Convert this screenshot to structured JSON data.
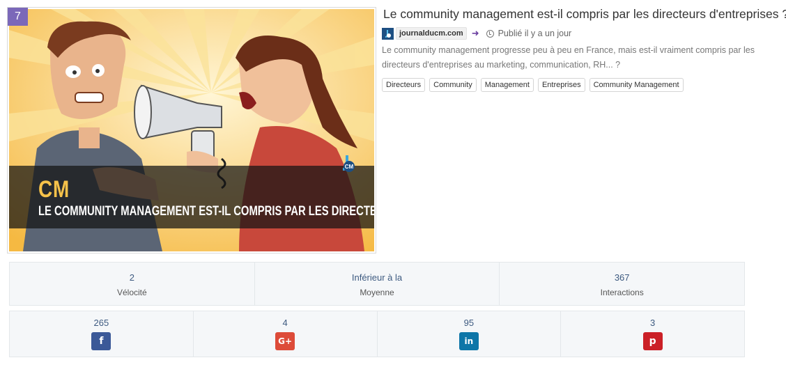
{
  "rank": "7",
  "article": {
    "title": "Le community management est-il compris par les directeurs d'entreprises ?",
    "source": "journalducm.com",
    "published": "Publié il y a un jour",
    "description": "Le community management progresse peu à peu en France, mais est-il vraiment compris par les directeurs d'entreprises au marketing, communication, RH... ?",
    "tags": [
      "Directeurs",
      "Community",
      "Management",
      "Entreprises",
      "Community Management"
    ]
  },
  "thumbnail": {
    "overlay_small": "CM",
    "overlay_headline": "LE COMMUNITY MANAGEMENT EST-IL COMPRIS PAR LES DIRECTEURS ?",
    "logo_text": "CM"
  },
  "stats": [
    {
      "value": "2",
      "label": "Vélocité"
    },
    {
      "value": "Inférieur à la",
      "label": "Moyenne"
    },
    {
      "value": "367",
      "label": "Interactions"
    }
  ],
  "social": [
    {
      "count": "265",
      "network": "facebook",
      "icon": "facebook-icon",
      "glyph": "f",
      "color": "#3b5998"
    },
    {
      "count": "4",
      "network": "google-plus",
      "icon": "google-plus-icon",
      "glyph": "G+",
      "color": "#dd4b39"
    },
    {
      "count": "95",
      "network": "linkedin",
      "icon": "linkedin-icon",
      "glyph": "in",
      "color": "#0e76a8"
    },
    {
      "count": "3",
      "network": "pinterest",
      "icon": "pinterest-icon",
      "glyph": "p",
      "color": "#cb2027"
    }
  ]
}
